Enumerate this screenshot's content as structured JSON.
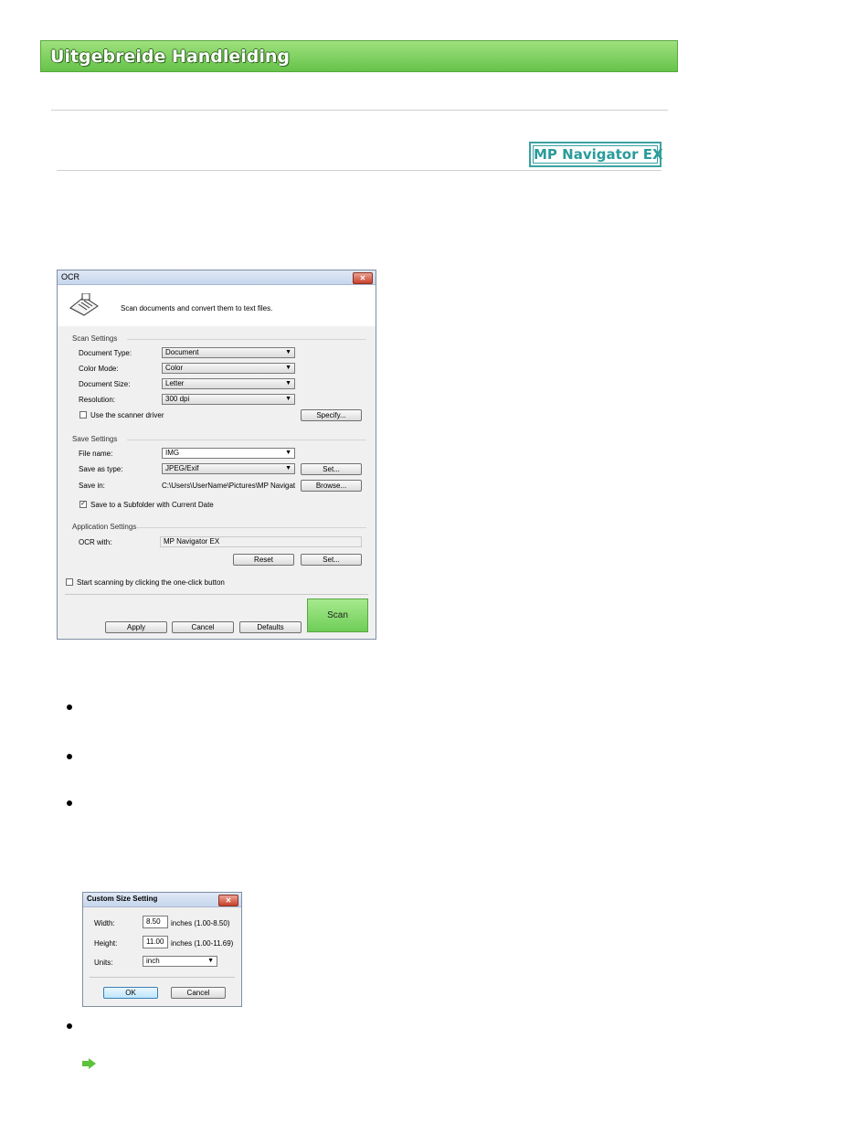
{
  "header": {
    "title": "Uitgebreide Handleiding"
  },
  "badge": {
    "label": "MP Navigator EX"
  },
  "ocr_dialog": {
    "title": "OCR",
    "description": "Scan documents and convert them to text files.",
    "scan_settings": {
      "title": "Scan Settings",
      "document_type_label": "Document Type:",
      "document_type_value": "Document",
      "color_mode_label": "Color Mode:",
      "color_mode_value": "Color",
      "document_size_label": "Document Size:",
      "document_size_value": "Letter",
      "resolution_label": "Resolution:",
      "resolution_value": "300 dpi",
      "use_driver_label": "Use the scanner driver",
      "specify_button": "Specify..."
    },
    "save_settings": {
      "title": "Save Settings",
      "file_name_label": "File name:",
      "file_name_value": "IMG",
      "save_as_type_label": "Save as type:",
      "save_as_type_value": "JPEG/Exif",
      "set_button": "Set...",
      "save_in_label": "Save in:",
      "save_in_value": "C:\\Users\\UserName\\Pictures\\MP Navigato",
      "browse_button": "Browse...",
      "subfolder_label": "Save to a Subfolder with Current Date"
    },
    "application_settings": {
      "title": "Application Settings",
      "ocr_with_label": "OCR with:",
      "ocr_with_value": "MP Navigator EX",
      "reset_button": "Reset",
      "set_button": "Set..."
    },
    "one_click_label": "Start scanning by clicking the one-click button",
    "apply_button": "Apply",
    "cancel_button": "Cancel",
    "defaults_button": "Defaults",
    "scan_button": "Scan"
  },
  "custom_size_dialog": {
    "title": "Custom Size Setting",
    "width_label": "Width:",
    "width_value": "8.50",
    "width_range": "inches (1.00-8.50)",
    "height_label": "Height:",
    "height_value": "11.00",
    "height_range": "inches (1.00-11.69)",
    "units_label": "Units:",
    "units_value": "inch",
    "ok_button": "OK",
    "cancel_button": "Cancel"
  },
  "colors": {
    "banner_green": "#66c34a",
    "badge_teal": "#2b9b9b",
    "scan_green": "#7fd56a"
  }
}
